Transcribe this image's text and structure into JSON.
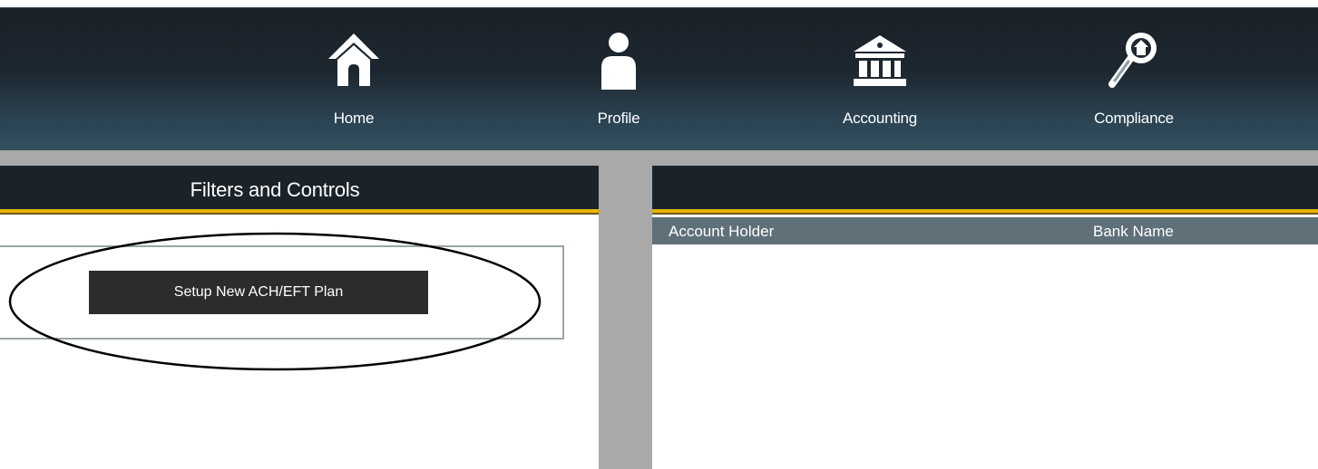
{
  "nav": {
    "items": [
      {
        "label": "Home",
        "icon": "home-icon"
      },
      {
        "label": "Profile",
        "icon": "person-icon"
      },
      {
        "label": "Accounting",
        "icon": "bank-icon"
      },
      {
        "label": "Compliance",
        "icon": "magnifier-icon"
      }
    ]
  },
  "left_panel": {
    "title": "Filters and Controls",
    "setup_button_label": "Setup New ACH/EFT Plan"
  },
  "grid": {
    "columns": [
      "Account Holder",
      "Bank Name"
    ]
  },
  "colors": {
    "header_dark": "#1b232a",
    "accent_gold": "#e8b400",
    "grid_header": "#5f7078",
    "splitter": "#a9a9a9",
    "button": "#2c2c2c"
  }
}
